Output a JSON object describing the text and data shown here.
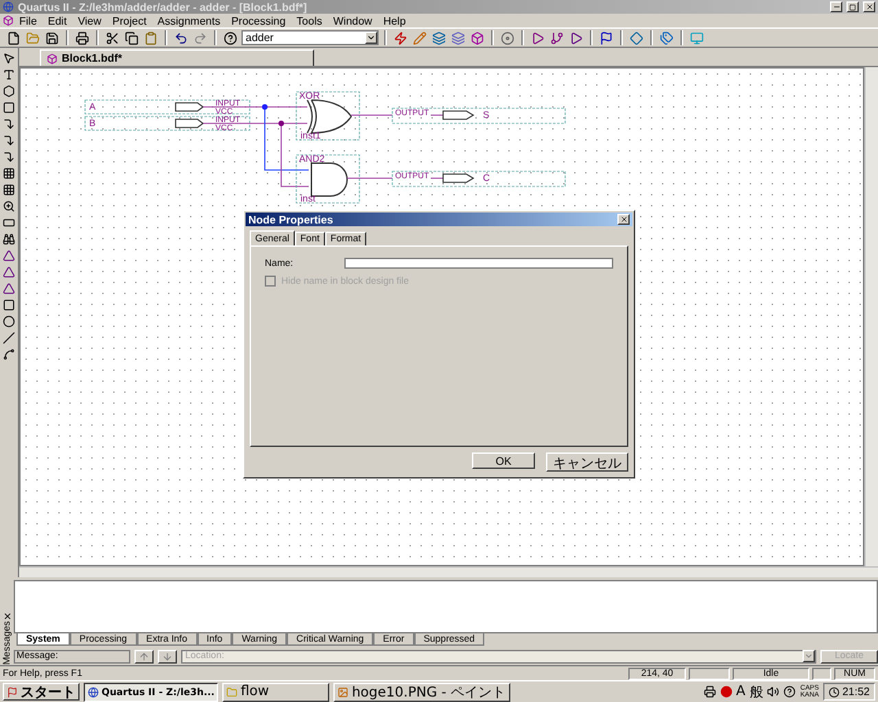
{
  "window": {
    "title": "Quartus II - Z:/le3hm/adder/adder - adder - [Block1.bdf*]"
  },
  "menu": [
    "File",
    "Edit",
    "View",
    "Project",
    "Assignments",
    "Processing",
    "Tools",
    "Window",
    "Help"
  ],
  "toolbar": {
    "combo_value": "adder"
  },
  "document_tabs": [
    {
      "label": "Block1.bdf*",
      "selected": true
    }
  ],
  "schematic": {
    "inputs": [
      {
        "name": "A",
        "type": "INPUT",
        "default": "VCC"
      },
      {
        "name": "B",
        "type": "INPUT",
        "default": "VCC"
      }
    ],
    "gates": [
      {
        "kind": "xor",
        "type": "XOR",
        "instance": "inst1"
      },
      {
        "kind": "and",
        "type": "AND2",
        "instance": "inst"
      }
    ],
    "outputs": [
      {
        "type": "OUTPUT",
        "name": "S"
      },
      {
        "type": "OUTPUT",
        "name": "C"
      }
    ]
  },
  "dialog": {
    "title": "Node Properties",
    "tabs": [
      {
        "label": "General",
        "selected": true
      },
      {
        "label": "Font",
        "selected": false
      },
      {
        "label": "Format",
        "selected": false
      }
    ],
    "name_label": "Name:",
    "hide_name": {
      "label": "Hide name in block design file",
      "checked": false,
      "disabled": true
    },
    "buttons": [
      "OK",
      "キャンセル"
    ]
  },
  "messages": {
    "side_label": "Messages",
    "tabs": [
      {
        "label": "System",
        "selected": true
      },
      {
        "label": "Processing",
        "selected": false
      },
      {
        "label": "Extra Info",
        "selected": false
      },
      {
        "label": "Info",
        "selected": false
      },
      {
        "label": "Warning",
        "selected": false
      },
      {
        "label": "Critical Warning",
        "selected": false
      },
      {
        "label": "Error",
        "selected": false
      },
      {
        "label": "Suppressed",
        "selected": false
      }
    ],
    "message_label": "Message:",
    "location": {
      "placeholder": "Location:",
      "disabled": true
    },
    "locate_button": "Locate"
  },
  "status_bar": {
    "help": "For Help, press F1",
    "coordinates": "214, 40",
    "state": "Idle",
    "num": "NUM"
  },
  "taskbar": {
    "start": "スタート",
    "tasks": [
      {
        "label": "Quartus II - Z:/le3h...",
        "selected": true
      },
      {
        "label": "flow",
        "selected": false
      },
      {
        "label": "hoge10.PNG - ペイント",
        "selected": false
      }
    ],
    "ime": [
      "A",
      "般"
    ],
    "caps": [
      "CAPS",
      "KANA"
    ],
    "clock": "21:52"
  }
}
